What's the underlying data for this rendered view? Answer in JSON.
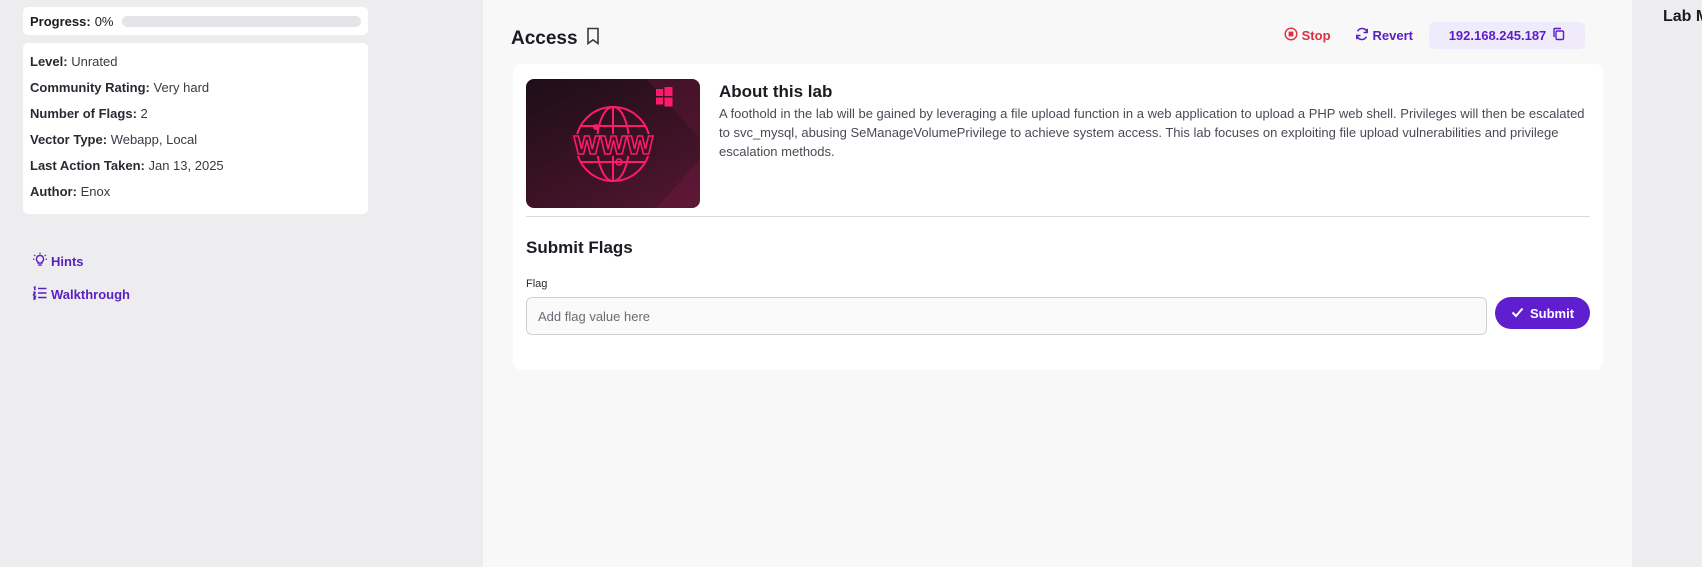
{
  "sidebar": {
    "progress": {
      "label": "Progress:",
      "value": "0%",
      "fraction": 0
    },
    "info": [
      {
        "key": "Level:",
        "value": "Unrated"
      },
      {
        "key": "Community Rating:",
        "value": "Very hard"
      },
      {
        "key": "Number of Flags:",
        "value": "2"
      },
      {
        "key": "Vector Type:",
        "value": "Webapp, Local"
      },
      {
        "key": "Last Action Taken:",
        "value": "Jan 13, 2025"
      },
      {
        "key": "Author:",
        "value": "Enox"
      }
    ],
    "links": [
      {
        "label": "Hints",
        "icon": "lightbulb-icon"
      },
      {
        "label": "Walkthrough",
        "icon": "list-icon"
      }
    ]
  },
  "main": {
    "title": "Access",
    "actions": {
      "stop_label": "Stop",
      "revert_label": "Revert",
      "ip": "192.168.245.187"
    },
    "about": {
      "title": "About this lab",
      "text": "A foothold in the lab will be gained by leveraging a file upload function in a web application to upload a PHP web shell. Privileges will then be escalated to svc_mysql, abusing SeManageVolumePrivilege to achieve system access. This lab focuses on exploiting file upload vulnerabilities and privilege escalation methods.",
      "thumbnail_text": "WWW"
    },
    "submit": {
      "title": "Submit Flags",
      "field_label": "Flag",
      "placeholder": "Add flag value here",
      "button_label": "Submit"
    }
  },
  "right_panel": {
    "title": "Lab M"
  },
  "colors": {
    "accent": "#5f1fcf",
    "danger": "#de2f3f",
    "thumb_pink": "#ff1a6c"
  }
}
